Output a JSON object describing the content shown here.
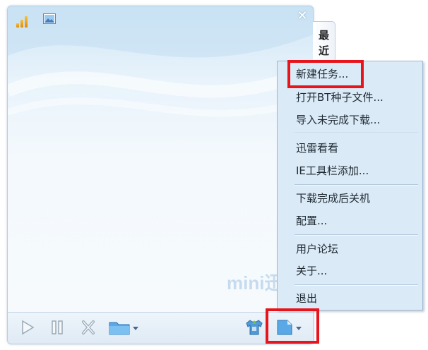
{
  "window": {
    "close_glyph": "✕",
    "watermark": "mini迅雷",
    "signal_icon": "signal-bars-icon",
    "picture_icon": "picture-icon"
  },
  "side_tab": {
    "label": "最近"
  },
  "toolbar": {
    "icons": [
      "play-icon",
      "pause-icon",
      "delete-icon",
      "folder-dropdown-icon",
      "shirt-skin-icon",
      "menu-dropdown-icon"
    ]
  },
  "menu": {
    "groups": [
      [
        "新建任务...",
        "打开BT种子文件...",
        "导入未完成下载..."
      ],
      [
        "迅雷看看",
        "IE工具栏添加..."
      ],
      [
        "下载完成后关机",
        "配置..."
      ],
      [
        "用户论坛",
        "关于..."
      ],
      [
        "退出"
      ]
    ]
  },
  "colors": {
    "highlight": "#e8141b",
    "menu_bg": "#dbeaf7",
    "accent": "#2f8fd8"
  }
}
